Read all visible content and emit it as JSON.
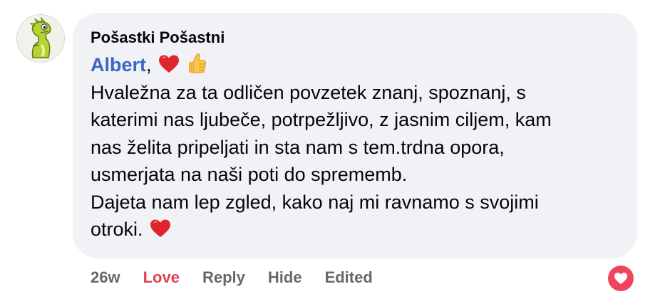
{
  "comment": {
    "author": "Pošastki Pošastni",
    "mention": "Albert",
    "first_line_suffix": ",",
    "lines": [
      "Hvaležna za ta odličen povzetek znanj, spoznanj, s",
      "katerimi nas ljubeče, potrpežljivo, z jasnim ciljem, kam",
      "nas želita pripeljati in sta nam s tem.trdna opora,",
      "usmerjata na naši poti do sprememb.",
      "Dajeta nam lep zgled, kako naj mi ravnamo s svojimi"
    ],
    "last_line": "otroki.",
    "emojis": [
      "heart-emoji",
      "thumbs-up-emoji"
    ]
  },
  "actions": {
    "time": "26w",
    "love": "Love",
    "reply": "Reply",
    "hide": "Hide",
    "edited": "Edited"
  },
  "reaction": {
    "icon": "heart-icon"
  },
  "colors": {
    "bubble": "#f0f2f5",
    "mention": "#3b66c4",
    "love": "#e03e52",
    "meta": "#65676b",
    "reaction_badge": "#f0435f"
  }
}
